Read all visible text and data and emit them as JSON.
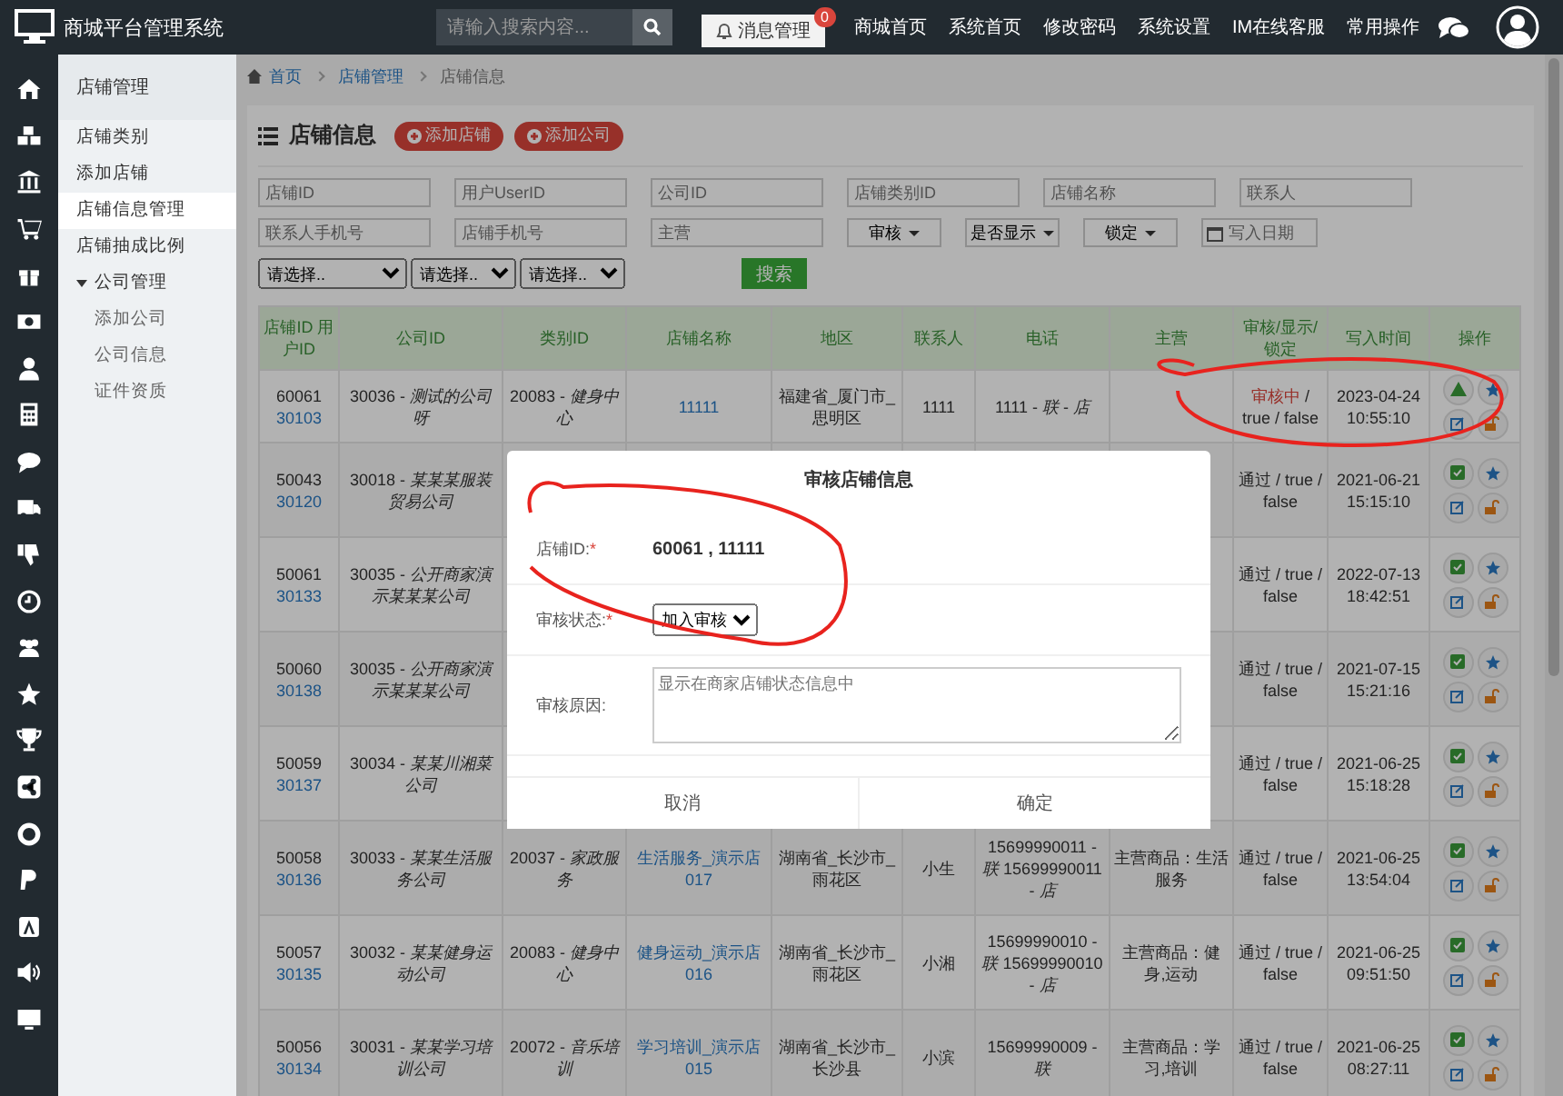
{
  "topbar": {
    "title": "商城平台管理系统",
    "search": {
      "placeholder": "请输入搜索内容..."
    },
    "message_button": {
      "label": "消息管理",
      "badge": "0"
    },
    "nav": [
      "商城首页",
      "系统首页",
      "修改密码",
      "系统设置",
      "IM在线客服",
      "常用操作"
    ]
  },
  "sidebar": {
    "title": "店铺管理",
    "items": [
      {
        "label": "店铺类别",
        "selected": false
      },
      {
        "label": "添加店铺",
        "selected": false
      },
      {
        "label": "店铺信息管理",
        "selected": true
      },
      {
        "label": "店铺抽成比例",
        "selected": false
      },
      {
        "label": "公司管理",
        "selected": false,
        "expanded": true,
        "children": [
          {
            "label": "添加公司",
            "selected": false
          },
          {
            "label": "公司信息",
            "selected": false
          },
          {
            "label": "证件资质",
            "selected": false
          }
        ]
      }
    ]
  },
  "breadcrumb": [
    "首页",
    "店铺管理",
    "店铺信息"
  ],
  "panel": {
    "title": "店铺信息",
    "buttons": [
      "添加店铺",
      "添加公司"
    ]
  },
  "filters": {
    "inputs": [
      {
        "placeholder": "店铺ID"
      },
      {
        "placeholder": "用户UserID"
      },
      {
        "placeholder": "公司ID"
      },
      {
        "placeholder": "店铺类别ID"
      },
      {
        "placeholder": "店铺名称"
      },
      {
        "placeholder": "联系人"
      },
      {
        "placeholder": "联系人手机号"
      },
      {
        "placeholder": "店铺手机号"
      },
      {
        "placeholder": "主营"
      }
    ],
    "dropdowns": [
      "审核",
      "是否显示",
      "锁定"
    ],
    "date": {
      "placeholder": "写入日期"
    },
    "selects": [
      "请选择..",
      "请选择..",
      "请选择.."
    ],
    "search_button": "搜索"
  },
  "table": {
    "columns": [
      "店铺ID 用户ID",
      "公司ID",
      "类别ID",
      "店铺名称",
      "地区",
      "联系人",
      "电话",
      "主营",
      "审核/显示/锁定",
      "写入时间",
      "操作"
    ],
    "rows": [
      {
        "shop_id": "60061",
        "user_id": "30103",
        "company": "30036 - *测试的公司呀*",
        "category": "20083 - *健身中心*",
        "name": "11111",
        "area": "福建省_厦门市_思明区",
        "contact": "1111",
        "phone": "1111 - *联* - *店*",
        "audit": {
          "status": "审核中",
          "pending": true,
          "detail": "/ true / false"
        },
        "time": "2023-04-24 10:55:10"
      },
      {
        "shop_id": "50043",
        "user_id": "30120",
        "company": "30018 - *某某某服装贸易公司*",
        "audit": {
          "status": "通过",
          "pending": false,
          "detail": "/ true / false"
        },
        "time": "2021-06-21 15:15:10"
      },
      {
        "shop_id": "50061",
        "user_id": "30133",
        "company": "30035 - *公开商家演示某某某公司*",
        "audit": {
          "status": "通过",
          "pending": false,
          "detail": "/ true / false"
        },
        "time": "2022-07-13 18:42:51"
      },
      {
        "shop_id": "50060",
        "user_id": "30138",
        "company": "30035 - *公开商家演示某某某公司*",
        "audit": {
          "status": "通过",
          "pending": false,
          "detail": "/ true / false"
        },
        "time": "2021-07-15 15:21:16"
      },
      {
        "shop_id": "50059",
        "user_id": "30137",
        "company": "30034 - *某某川湘菜公司*",
        "audit": {
          "status": "通过",
          "pending": false,
          "detail": "/ true / false"
        },
        "time": "2021-06-25 15:18:28"
      },
      {
        "shop_id": "50058",
        "user_id": "30136",
        "company": "30033 - *某某生活服务公司*",
        "category": "20037 - *家政服务*",
        "name": "生活服务_演示店017",
        "area": "湖南省_长沙市_雨花区",
        "contact": "小生",
        "phone": "15699990011 - *联* 15699990011 - *店*",
        "main": "主营商品：生活服务",
        "audit": {
          "status": "通过",
          "pending": false,
          "detail": "/ true / false"
        },
        "time": "2021-06-25 13:54:04"
      },
      {
        "shop_id": "50057",
        "user_id": "30135",
        "company": "30032 - *某某健身运动公司*",
        "category": "20083 - *健身中心*",
        "name": "健身运动_演示店016",
        "area": "湖南省_长沙市_雨花区",
        "contact": "小湘",
        "phone": "15699990010 - *联* 15699990010 - *店*",
        "main": "主营商品：健身,运动",
        "audit": {
          "status": "通过",
          "pending": false,
          "detail": "/ true / false"
        },
        "time": "2021-06-25 09:51:50"
      },
      {
        "shop_id": "50056",
        "user_id": "30134",
        "company": "30031 - *某某学习培训公司*",
        "category": "20072 - *音乐培训*",
        "name": "学习培训_演示店015",
        "area": "湖南省_长沙市_长沙县",
        "contact": "小滨",
        "phone": "15699990009 - *联*",
        "main": "主营商品：学习,培训",
        "audit": {
          "status": "通过",
          "pending": false,
          "detail": "/ true / false"
        },
        "time": "2021-06-25 08:27:11"
      }
    ]
  },
  "dialog": {
    "title": "审核店铺信息",
    "fields": [
      {
        "kind": "value",
        "label": "店铺ID:",
        "mark": "*",
        "value": "60061 , 11111"
      },
      {
        "kind": "select",
        "label": "审核状态:",
        "mark": "*",
        "value": "加入审核"
      },
      {
        "kind": "textarea",
        "label": "审核原因:",
        "placeholder": "显示在商家店铺状态信息中"
      }
    ],
    "buttons": [
      "取消",
      "确定"
    ]
  }
}
